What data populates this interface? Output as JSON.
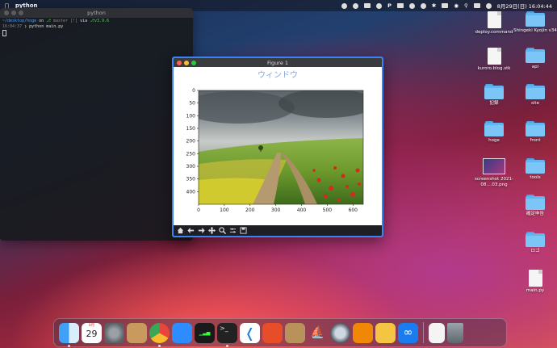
{
  "menubar": {
    "app_name": "python",
    "datetime": "8月29日(日)  16:04:44"
  },
  "terminal": {
    "title": "python",
    "line1_path": "~/desktop/hoge",
    "line1_on": "on",
    "line1_branch": "master [!]",
    "line1_via": "via",
    "line1_version": "v3.9.6",
    "line2_time": "16:04:37",
    "line2_cmd": "python main.py"
  },
  "figure": {
    "window_title": "Figure 1",
    "plot_title": "ウィンドウ",
    "title_color": "#7fa8e0",
    "y_ticks": [
      "0",
      "50",
      "100",
      "150",
      "200",
      "250",
      "300",
      "350",
      "400"
    ],
    "x_ticks": [
      "0",
      "100",
      "200",
      "300",
      "400",
      "500",
      "600"
    ],
    "image_width": 640,
    "image_height": 450,
    "toolbar_icons": [
      "home-icon",
      "back-arrow-icon",
      "forward-arrow-icon",
      "pan-icon",
      "zoom-icon",
      "configure-icon",
      "save-icon"
    ]
  },
  "desktop_icons": [
    {
      "label": "deploy.command",
      "kind": "doc"
    },
    {
      "label": "Shingeki Kyojin v34",
      "kind": "folder"
    },
    {
      "label": "kuroro.blog.stk",
      "kind": "doc"
    },
    {
      "label": "api",
      "kind": "folder"
    },
    {
      "label": "記録",
      "kind": "folder"
    },
    {
      "label": "site",
      "kind": "folder"
    },
    {
      "label": "hoge",
      "kind": "folder"
    },
    {
      "label": "front",
      "kind": "folder"
    },
    {
      "label": "screenshot 2021-08....03.png",
      "kind": "image"
    },
    {
      "label": "tools",
      "kind": "folder"
    },
    {
      "label": "確定申告",
      "kind": "folder"
    },
    {
      "label": "ロゴ",
      "kind": "folder"
    },
    {
      "label": "main.py",
      "kind": "doc"
    }
  ],
  "dock": {
    "calendar_month": "8月",
    "calendar_day": "29",
    "apps": [
      "finder-icon",
      "calendar-icon",
      "system-preferences-icon",
      "contacts-icon",
      "chrome-icon",
      "zoom-icon",
      "activity-monitor-icon",
      "terminal-icon",
      "vscode-icon",
      "instruments-icon",
      "archive-utility-icon",
      "docker-icon",
      "quicktime-icon",
      "drawio-icon",
      "preview-icon",
      "infinity-icon",
      "document-icon",
      "trash-icon"
    ]
  }
}
